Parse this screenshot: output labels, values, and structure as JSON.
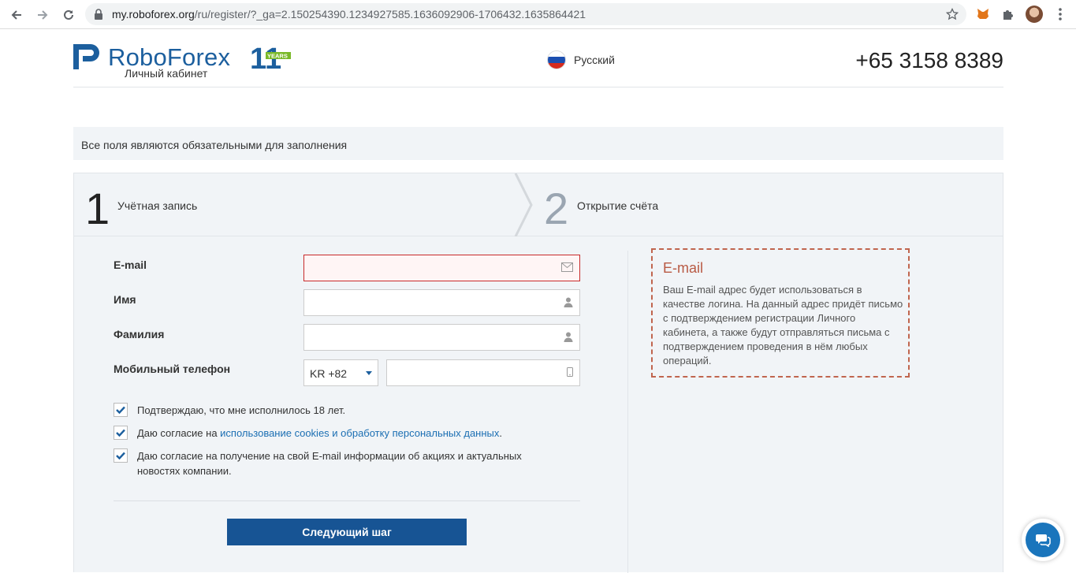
{
  "browser": {
    "url_host": "my.roboforex.org",
    "url_path": "/ru/register/?_ga=2.150254390.1234927585.1636092906-1706432.1635864421"
  },
  "header": {
    "brand": "RoboForex",
    "subtitle": "Личный кабинет",
    "years_badge": "YEARS",
    "years_number": "11",
    "language": "Русский",
    "phone": "+65 3158 8389"
  },
  "notice": "Все поля являются обязательными для заполнения",
  "steps": [
    {
      "number": "1",
      "label": "Учётная запись",
      "active": true
    },
    {
      "number": "2",
      "label": "Открытие счёта",
      "active": false
    }
  ],
  "form": {
    "email_label": "E-mail",
    "email_value": "",
    "first_name_label": "Имя",
    "last_name_label": "Фамилия",
    "phone_label": "Мобильный телефон",
    "country_code": "KR +82",
    "phone_value": ""
  },
  "checkboxes": [
    {
      "text": "Подтверждаю, что мне исполнилось 18 лет.",
      "checked": true
    },
    {
      "text_before": "Даю согласие на ",
      "link": "использование cookies и обработку персональных данных",
      "text_after": ".",
      "checked": true
    },
    {
      "text": "Даю согласие на получение на свой E-mail информации об акциях и актуальных новостях компании.",
      "checked": true
    }
  ],
  "next_button": "Следующий шаг",
  "hint": {
    "title": "E-mail",
    "body": "Ваш E-mail адрес будет использоваться в качестве логина. На данный адрес придёт письмо с подтверждением регистрации Личного кабинета, а также будут отправляться письма с подтверждением проведения в нём любых операций."
  },
  "colors": {
    "brand_blue": "#1c5f9e",
    "button_blue": "#175494",
    "error_red": "#c82a2a",
    "hint_border": "#c0654e"
  }
}
